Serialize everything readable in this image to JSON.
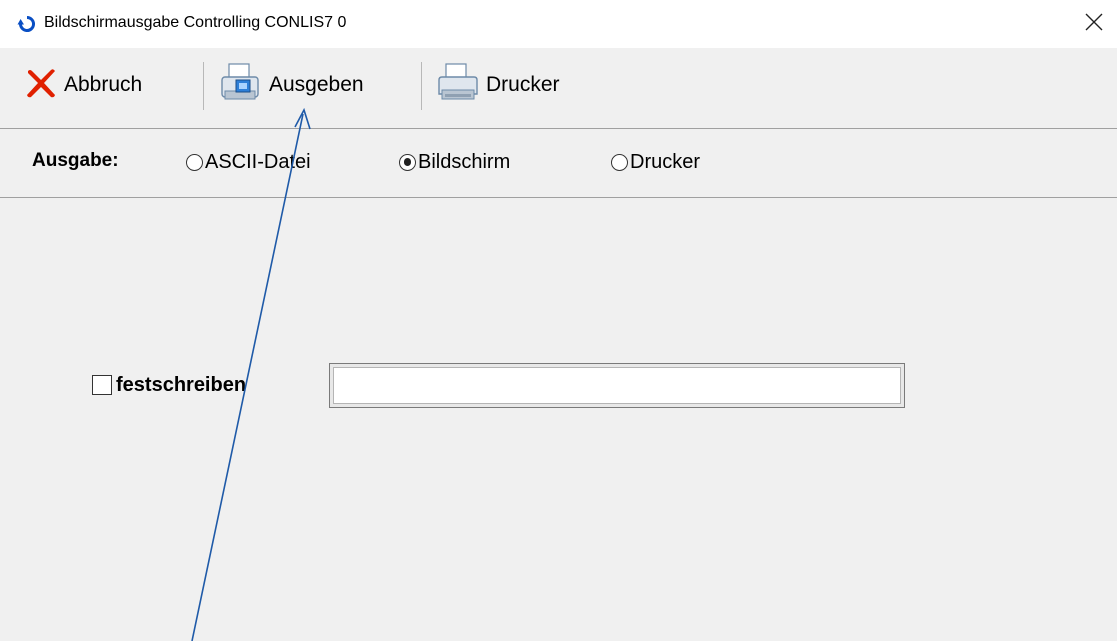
{
  "window": {
    "title": "Bildschirmausgabe  Controlling  CONLIS7 0",
    "icon": "refresh-circle-icon",
    "close_icon": "close-icon"
  },
  "toolbar": {
    "buttons": [
      {
        "label": "Abbruch",
        "icon": "red-x-cancel-icon"
      },
      {
        "label": "Ausgeben",
        "icon": "printer-preview-icon"
      },
      {
        "label": "Drucker",
        "icon": "printer-icon"
      }
    ]
  },
  "output": {
    "label": "Ausgabe:",
    "options": [
      {
        "label": "ASCII-Datei",
        "selected": false
      },
      {
        "label": "Bildschirm",
        "selected": true
      },
      {
        "label": "Drucker",
        "selected": false
      }
    ]
  },
  "form": {
    "checkbox_label": "festschreiben",
    "checkbox_checked": false,
    "text_value": ""
  },
  "colors": {
    "accent_blue": "#0a4fc4",
    "cancel_red": "#e02000",
    "annotation_arrow": "#1f5aa8",
    "background": "#f0f0f0"
  }
}
